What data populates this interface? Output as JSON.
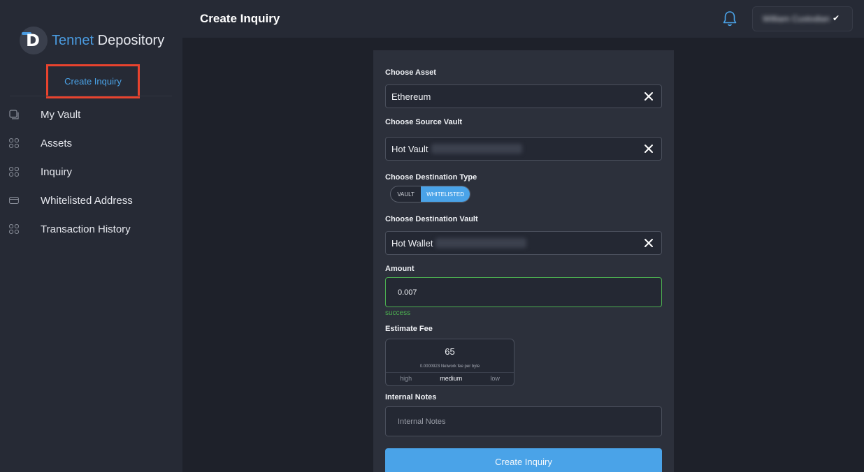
{
  "brand": {
    "name_part1": "Tennet",
    "name_part2": "Depository"
  },
  "sidebar": {
    "create_link": "Create Inquiry",
    "items": [
      {
        "label": "My Vault",
        "icon": "vault-icon"
      },
      {
        "label": "Assets",
        "icon": "grid-icon"
      },
      {
        "label": "Inquiry",
        "icon": "grid-icon"
      },
      {
        "label": "Whitelisted Address",
        "icon": "card-icon"
      },
      {
        "label": "Transaction History",
        "icon": "grid-icon"
      }
    ]
  },
  "header": {
    "title": "Create Inquiry",
    "user_name": "William Custodian"
  },
  "form": {
    "asset": {
      "label": "Choose Asset",
      "value": "Ethereum"
    },
    "source_vault": {
      "label": "Choose Source Vault",
      "value": "Hot Vault"
    },
    "destination_type": {
      "label": "Choose Destination Type",
      "options": [
        "VAULT",
        "WHITELISTED"
      ],
      "selected": "WHITELISTED"
    },
    "destination_vault": {
      "label": "Choose Destination Vault",
      "value": "Hot Wallet"
    },
    "amount": {
      "label": "Amount",
      "value": "0.007",
      "status": "success"
    },
    "fee": {
      "label": "Estimate Fee",
      "value": "65",
      "sub_value": "0.0000923",
      "sub_text": "Network fee per byte",
      "options": [
        "high",
        "medium",
        "low"
      ],
      "selected": "medium"
    },
    "notes": {
      "label": "Internal Notes",
      "placeholder": "Internal Notes"
    },
    "submit_label": "Create Inquiry"
  },
  "colors": {
    "accent": "#4aa3e8",
    "success": "#4caf50",
    "highlight_border": "#e8432e"
  }
}
